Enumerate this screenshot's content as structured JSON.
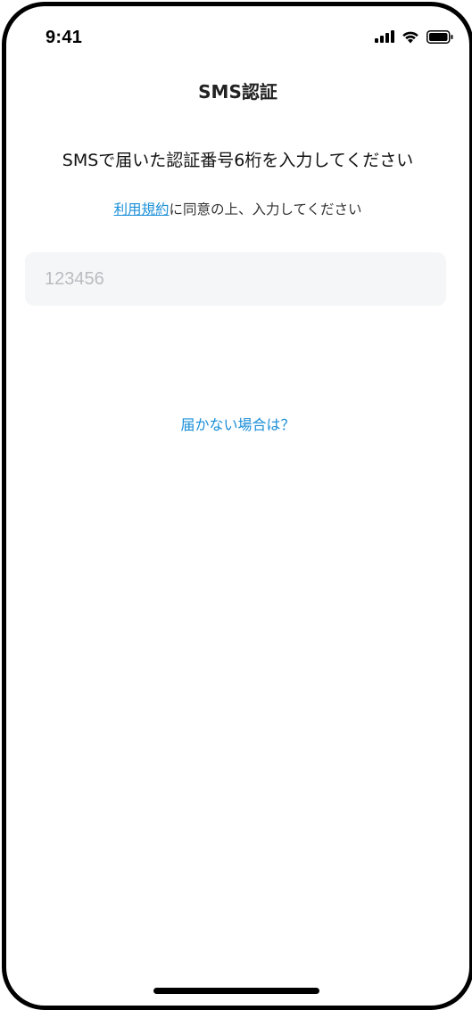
{
  "status_bar": {
    "time": "9:41",
    "icons": [
      "cellular-signal-icon",
      "wifi-icon",
      "battery-icon"
    ]
  },
  "header": {
    "title": "SMS認証"
  },
  "main": {
    "heading": "SMSで届いた認証番号6桁を入力してください",
    "terms": {
      "link_label": "利用規約",
      "rest_text": "に同意の上、入力してください"
    },
    "code_input": {
      "placeholder": "123456",
      "value": ""
    },
    "resend_link": "届かない場合は？"
  },
  "colors": {
    "accent": "#1a8fd8",
    "input_background": "#f5f6f8",
    "placeholder": "#b9bcc0",
    "text": "#111111"
  }
}
